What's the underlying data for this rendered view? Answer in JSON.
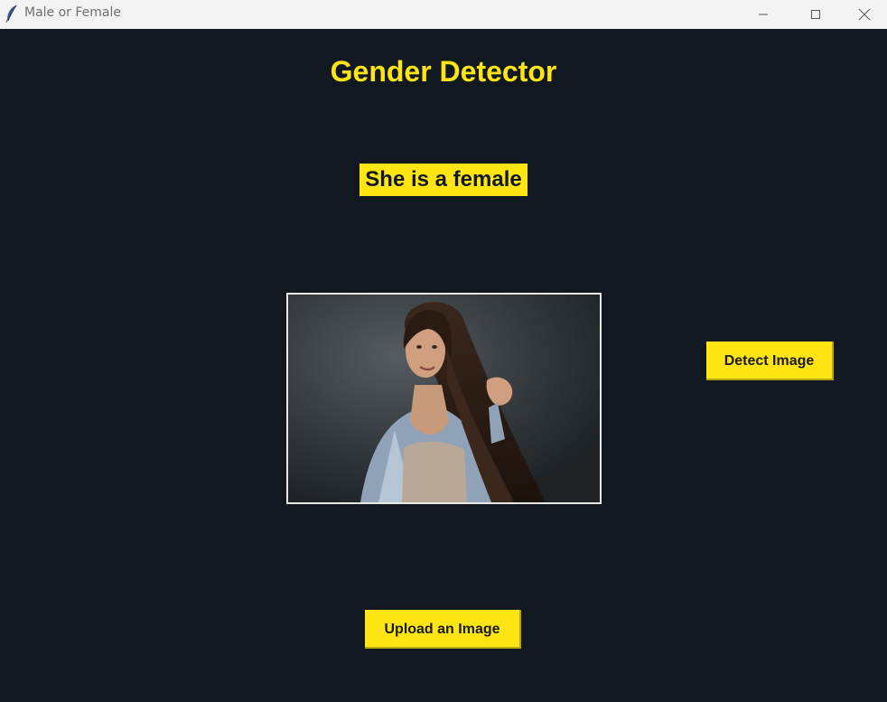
{
  "window": {
    "title": "Male or Female",
    "icon": "feather-icon",
    "controls": {
      "minimize": "minimize-icon",
      "maximize": "maximize-icon",
      "close": "close-icon"
    }
  },
  "main": {
    "heading": "Gender Detector",
    "result": "She is a female",
    "image": {
      "description": "portrait-photo"
    },
    "buttons": {
      "detect_label": "Detect Image",
      "upload_label": "Upload an Image"
    }
  },
  "colors": {
    "background": "#111820",
    "accent": "#ffe512",
    "titlebar": "#f3f3f3"
  }
}
